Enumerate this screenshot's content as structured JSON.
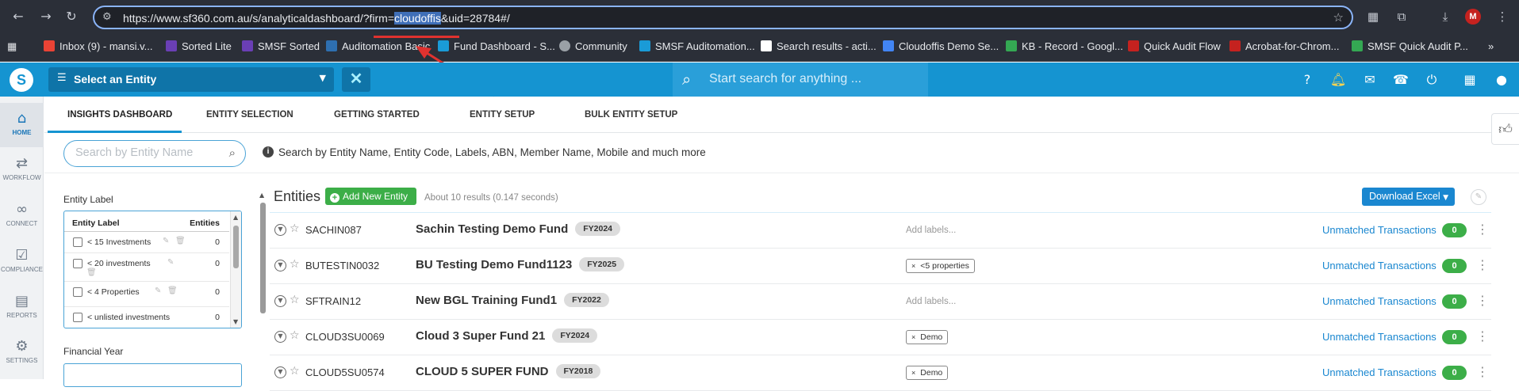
{
  "browser": {
    "url_prefix": "https://www.sf360.com.au/s/analyticaldashboard/?firm=",
    "url_highlight": "cloudoffis",
    "url_suffix": "&uid=28784#/",
    "profile_initial": "M"
  },
  "bookmarks": [
    {
      "label": "Inbox (9) - mansi.v...",
      "color": "#ea4335"
    },
    {
      "label": "Sorted Lite",
      "color": "#6a3fb5"
    },
    {
      "label": "SMSF Sorted",
      "color": "#6a3fb5"
    },
    {
      "label": "Auditomation Basic",
      "color": "#2e6fb0"
    },
    {
      "label": "Fund Dashboard - S...",
      "color": "#1a9bd7"
    },
    {
      "label": "Community",
      "color": "#9aa0a6"
    },
    {
      "label": "SMSF Auditomation...",
      "color": "#1a9bd7"
    },
    {
      "label": "Search results - acti...",
      "color": "#ffffff"
    },
    {
      "label": "Cloudoffis Demo Se...",
      "color": "#4285f4"
    },
    {
      "label": "KB - Record - Googl...",
      "color": "#34a853"
    },
    {
      "label": "Quick Audit Flow",
      "color": "#c5221f"
    },
    {
      "label": "Acrobat-for-Chrom...",
      "color": "#c5221f"
    },
    {
      "label": "SMSF Quick Audit P...",
      "color": "#34a853"
    }
  ],
  "app": {
    "entity_select_label": "Select an Entity",
    "search_placeholder": "Start search for anything ..."
  },
  "rail": [
    {
      "label": "HOME",
      "icon": "home-icon",
      "active": true
    },
    {
      "label": "WORKFLOW",
      "icon": "workflow-icon",
      "active": false
    },
    {
      "label": "CONNECT",
      "icon": "link-icon",
      "active": false
    },
    {
      "label": "COMPLIANCE",
      "icon": "compliance-icon",
      "active": false
    },
    {
      "label": "REPORTS",
      "icon": "reports-icon",
      "active": false
    },
    {
      "label": "SETTINGS",
      "icon": "gear-icon",
      "active": false
    }
  ],
  "tabs": [
    "INSIGHTS DASHBOARD",
    "ENTITY SELECTION",
    "GETTING STARTED",
    "ENTITY SETUP",
    "BULK ENTITY SETUP"
  ],
  "search": {
    "placeholder": "Search by Entity Name",
    "info": "Search by Entity Name, Entity Code, Labels, ABN, Member Name, Mobile and much more"
  },
  "filters": {
    "entity_label_title": "Entity Label",
    "col_label": "Entity Label",
    "col_entities": "Entities",
    "labels": [
      {
        "name": "< 15 Investments",
        "count": "0"
      },
      {
        "name": "< 20 investments",
        "count": "0"
      },
      {
        "name": "< 4 Properties",
        "count": "0"
      },
      {
        "name": "< unlisted investments",
        "count": "0"
      }
    ],
    "financial_year_title": "Financial Year"
  },
  "entities": {
    "title": "Entities",
    "add_button": "Add New Entity",
    "meta": "About 10 results (0.147 seconds)",
    "download_button": "Download Excel",
    "rows": [
      {
        "code": "SACHIN087",
        "name": "Sachin Testing Demo Fund",
        "fy": "FY2024",
        "label_kind": "add",
        "label": "Add labels...",
        "action": "Unmatched Transactions",
        "count": "0"
      },
      {
        "code": "BUTESTIN0032",
        "name": "BU Testing Demo Fund1123",
        "fy": "FY2025",
        "label_kind": "tag",
        "label": "<5 properties",
        "action": "Unmatched Transactions",
        "count": "0"
      },
      {
        "code": "SFTRAIN12",
        "name": "New BGL Training Fund1",
        "fy": "FY2022",
        "label_kind": "add",
        "label": "Add labels...",
        "action": "Unmatched Transactions",
        "count": "0"
      },
      {
        "code": "CLOUD3SU0069",
        "name": "Cloud 3 Super Fund 21",
        "fy": "FY2024",
        "label_kind": "tag",
        "label": "Demo",
        "action": "Unmatched Transactions",
        "count": "0"
      },
      {
        "code": "CLOUD5SU0574",
        "name": "CLOUD 5 SUPER FUND",
        "fy": "FY2018",
        "label_kind": "tag",
        "label": "Demo",
        "action": "Unmatched Transactions",
        "count": "0"
      }
    ]
  }
}
